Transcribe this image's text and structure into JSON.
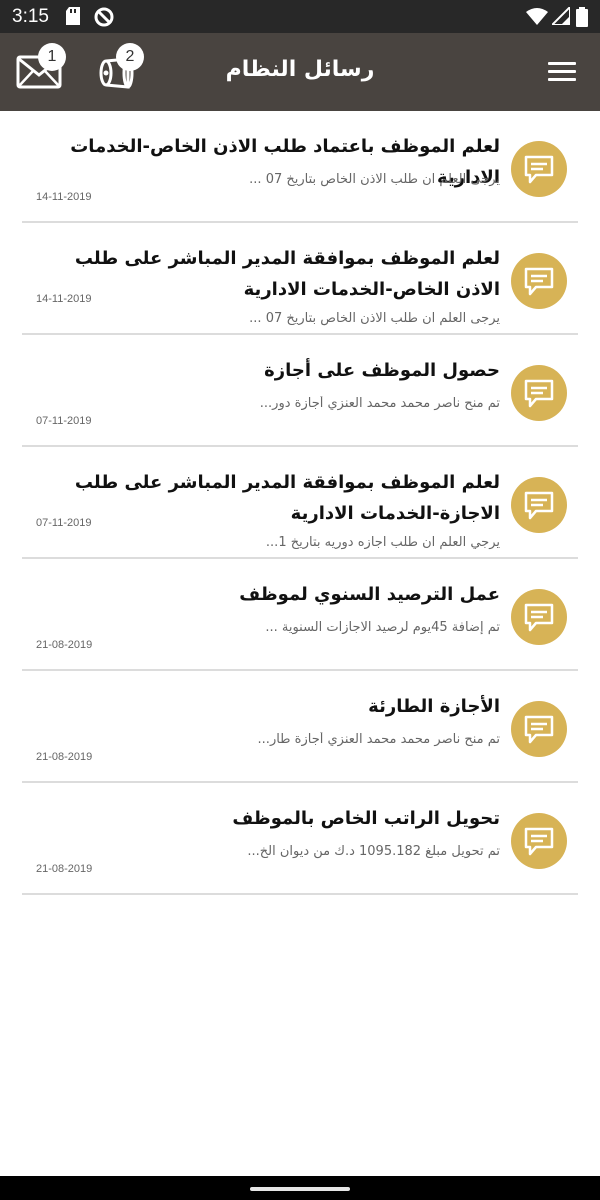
{
  "status_bar": {
    "time": "3:15"
  },
  "app_bar": {
    "title": "رسائل النظام",
    "inbox_badge": "1",
    "announce_badge": "2"
  },
  "colors": {
    "accent": "#d7b356",
    "app_bar": "#494440",
    "status_bar": "#282828"
  },
  "messages": [
    {
      "title": "لعلم الموظف باعتماد طلب الاذن الخاص-الخدمات الادارية",
      "preview": "يرجى العلم ان طلب الاذن الخاص بتاريخ 07 ...",
      "date": "14-11-2019"
    },
    {
      "title": "لعلم الموظف بموافقة المدير المباشر على  طلب الاذن الخاص-الخدمات الادارية",
      "preview": "يرجى العلم ان طلب الاذن الخاص بتاريخ 07 ...",
      "date": "14-11-2019"
    },
    {
      "title": "حصول الموظف على أجازة",
      "preview": "تم منح ناصر محمد محمد العنزي أجازة دور...",
      "date": "07-11-2019"
    },
    {
      "title": "لعلم الموظف بموافقة المدير المباشر على طلب الاجازة-الخدمات الادارية",
      "preview": "يرجي العلم ان طلب اجازه دوريه بتاريخ 1...",
      "date": "07-11-2019"
    },
    {
      "title": "عمل الترصيد السنوي لموظف",
      "preview": "تم إضافة 45يوم لرصيد الاجازات السنوية ...",
      "date": "21-08-2019"
    },
    {
      "title": "الأجازة الطارئة",
      "preview": "تم منح ناصر محمد محمد العنزي أجازة طار...",
      "date": "21-08-2019"
    },
    {
      "title": "تحويل الراتب الخاص بالموظف",
      "preview": "تم تحويل مبلغ 1095.182 د.ك من ديوان الخ...",
      "date": "21-08-2019"
    }
  ]
}
